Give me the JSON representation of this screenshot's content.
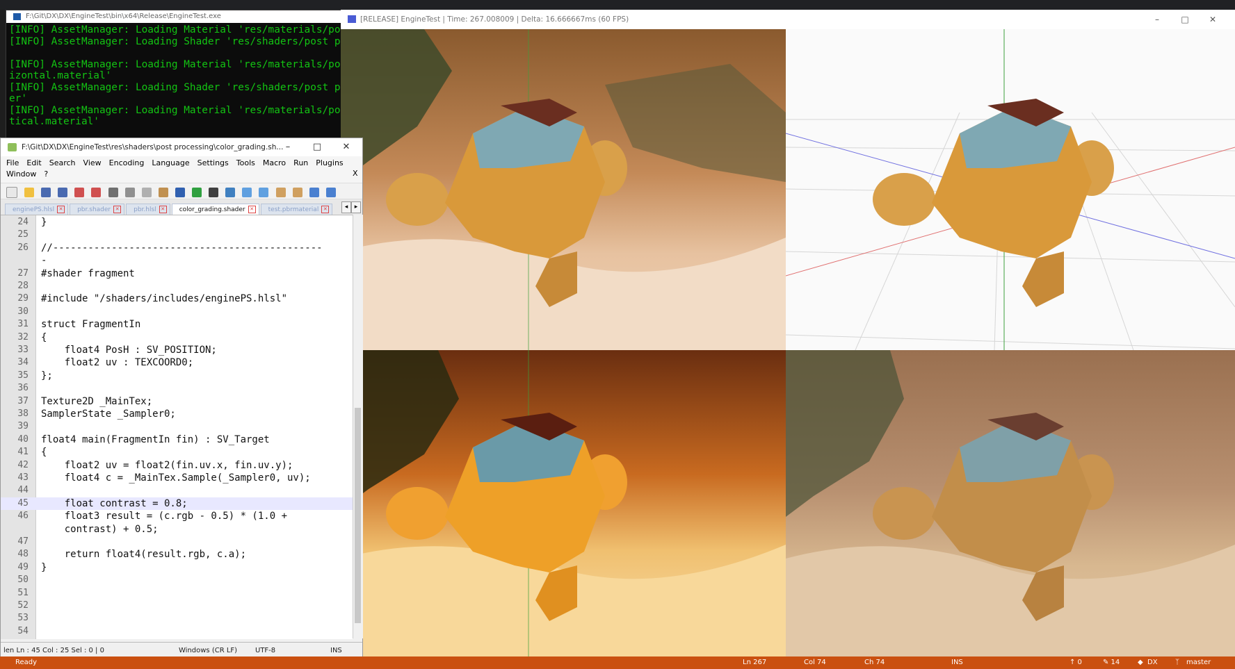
{
  "console": {
    "title": "F:\\Git\\DX\\DX\\EngineTest\\bin\\x64\\Release\\EngineTest.exe",
    "lines": [
      "[INFO] AssetManager: Loading Material 'res/materials/post",
      "[INFO] AssetManager: Loading Shader 'res/shaders/post proc",
      "",
      "[INFO] AssetManager: Loading Material 'res/materials/post",
      "izontal.material'",
      "[INFO] AssetManager: Loading Shader 'res/shaders/post proc",
      "er'",
      "[INFO] AssetManager: Loading Material 'res/materials/post",
      "tical.material'"
    ]
  },
  "engine": {
    "title": "[RELEASE] EngineTest | Time: 267.008009 | Delta: 16.666667ms (60 FPS)",
    "minimize": "–",
    "maximize": "□",
    "close": "✕"
  },
  "notepad": {
    "title": "F:\\Git\\DX\\DX\\EngineTest\\res\\shaders\\post processing\\color_grading.sh...",
    "minimize": "–",
    "maximize": "□",
    "close": "✕",
    "menu": [
      "File",
      "Edit",
      "Search",
      "View",
      "Encoding",
      "Language",
      "Settings",
      "Tools",
      "Macro",
      "Run",
      "Plugins",
      "Window",
      "?"
    ],
    "menu_close": "X",
    "tabs": [
      {
        "label": "enginePS.hlsl",
        "active": false
      },
      {
        "label": "pbr.shader",
        "active": false
      },
      {
        "label": "pbr.hlsl",
        "active": false
      },
      {
        "label": "color_grading.shader",
        "active": true
      },
      {
        "label": "test.pbrmaterial",
        "active": false
      }
    ],
    "tab_nav": [
      "◂",
      "▸"
    ],
    "lines": [
      {
        "n": "24",
        "t": "}"
      },
      {
        "n": "25",
        "t": ""
      },
      {
        "n": "26",
        "t": "//----------------------------------------------"
      },
      {
        "n": "",
        "t": "-"
      },
      {
        "n": "27",
        "t": "#shader fragment"
      },
      {
        "n": "28",
        "t": ""
      },
      {
        "n": "29",
        "t": "#include \"/shaders/includes/enginePS.hlsl\""
      },
      {
        "n": "30",
        "t": ""
      },
      {
        "n": "31",
        "t": "struct FragmentIn"
      },
      {
        "n": "32",
        "t": "{"
      },
      {
        "n": "33",
        "t": "    float4 PosH : SV_POSITION;"
      },
      {
        "n": "34",
        "t": "    float2 uv : TEXCOORD0;"
      },
      {
        "n": "35",
        "t": "};"
      },
      {
        "n": "36",
        "t": ""
      },
      {
        "n": "37",
        "t": "Texture2D _MainTex;"
      },
      {
        "n": "38",
        "t": "SamplerState _Sampler0;"
      },
      {
        "n": "39",
        "t": ""
      },
      {
        "n": "40",
        "t": "float4 main(FragmentIn fin) : SV_Target"
      },
      {
        "n": "41",
        "t": "{"
      },
      {
        "n": "42",
        "t": "    float2 uv = float2(fin.uv.x, fin.uv.y);"
      },
      {
        "n": "43",
        "t": "    float4 c = _MainTex.Sample(_Sampler0, uv);"
      },
      {
        "n": "44",
        "t": ""
      },
      {
        "n": "45",
        "t": "    float contrast = 0.8;"
      },
      {
        "n": "46",
        "t": "    float3 result = (c.rgb - 0.5) * (1.0 +"
      },
      {
        "n": "",
        "t": "    contrast) + 0.5;"
      },
      {
        "n": "47",
        "t": ""
      },
      {
        "n": "48",
        "t": "    return float4(result.rgb, c.a);"
      },
      {
        "n": "49",
        "t": "}"
      },
      {
        "n": "50",
        "t": ""
      },
      {
        "n": "51",
        "t": ""
      },
      {
        "n": "52",
        "t": ""
      },
      {
        "n": "53",
        "t": ""
      },
      {
        "n": "54",
        "t": ""
      }
    ],
    "current_line": "45",
    "status": {
      "position": "len Ln : 45    Col : 25    Sel : 0 | 0",
      "eol": "Windows (CR LF)",
      "encoding": "UTF-8",
      "mode": "INS"
    }
  },
  "ide_status": {
    "ready": "Ready",
    "ln": "Ln 267",
    "col": "Col 74",
    "ch": "Ch 74",
    "ins": "INS",
    "up": "↑ 0",
    "pencil": "✎ 14",
    "repo": "DX",
    "branch": "master"
  },
  "colors": {
    "console_text": "#13c413",
    "statusbar": "#ca5010",
    "sky_sand": "#d9a373",
    "rock": "#e7c3a0",
    "monkey_gold": "#d99a3c",
    "monkey_cap": "#7fa8b3"
  }
}
